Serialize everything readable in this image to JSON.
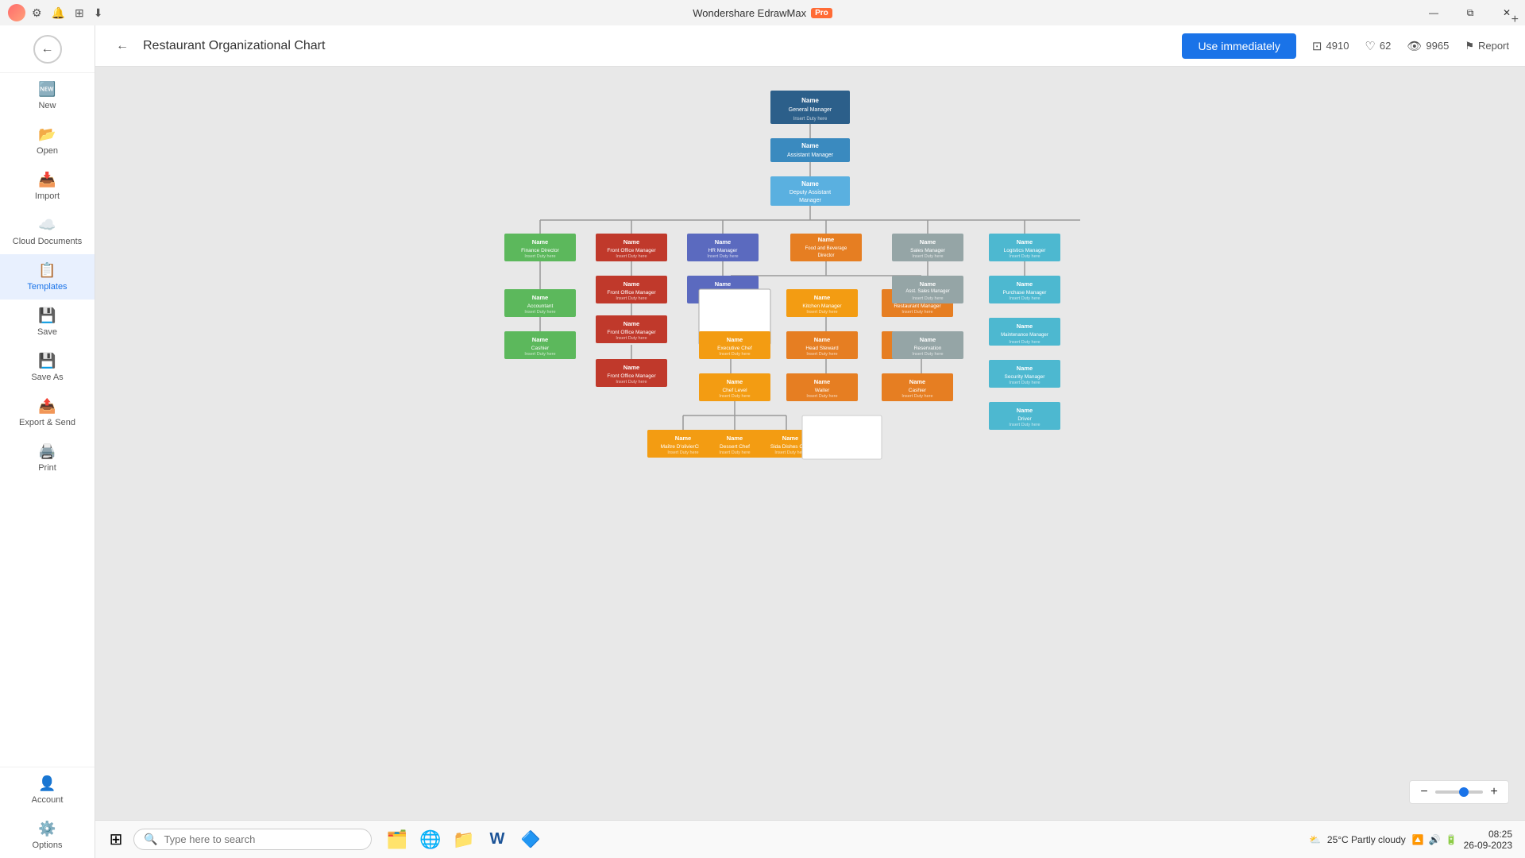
{
  "titleBar": {
    "appName": "Wondershare EdrawMax",
    "proBadge": "Pro",
    "windowControls": [
      "—",
      "⧉",
      "✕"
    ]
  },
  "header": {
    "title": "Restaurant Organizational Chart",
    "useImmediatelyBtn": "Use immediately",
    "stats": {
      "saves": "4910",
      "likes": "62",
      "views": "9965",
      "report": "Report"
    }
  },
  "sidebar": {
    "items": [
      {
        "id": "new",
        "label": "New",
        "icon": "➕"
      },
      {
        "id": "open",
        "label": "Open",
        "icon": "📂"
      },
      {
        "id": "import",
        "label": "Import",
        "icon": "📥"
      },
      {
        "id": "cloud",
        "label": "Cloud Documents",
        "icon": "☁️"
      },
      {
        "id": "templates",
        "label": "Templates",
        "icon": "📋"
      },
      {
        "id": "save",
        "label": "Save",
        "icon": "💾"
      },
      {
        "id": "saveas",
        "label": "Save As",
        "icon": "💾"
      },
      {
        "id": "export",
        "label": "Export & Send",
        "icon": "📤"
      },
      {
        "id": "print",
        "label": "Print",
        "icon": "🖨️"
      }
    ],
    "bottomItems": [
      {
        "id": "account",
        "label": "Account",
        "icon": "👤"
      },
      {
        "id": "options",
        "label": "Options",
        "icon": "⚙️"
      }
    ]
  },
  "taskbar": {
    "searchPlaceholder": "Type here to search",
    "apps": [
      "🪟",
      "🗂️",
      "🌐",
      "📁",
      "📝",
      "🔵"
    ],
    "weather": "25°C  Partly cloudy",
    "time": "08:25",
    "date": "26-09-2023"
  },
  "orgChart": {
    "title": "Restaurant Organizational Chart"
  }
}
